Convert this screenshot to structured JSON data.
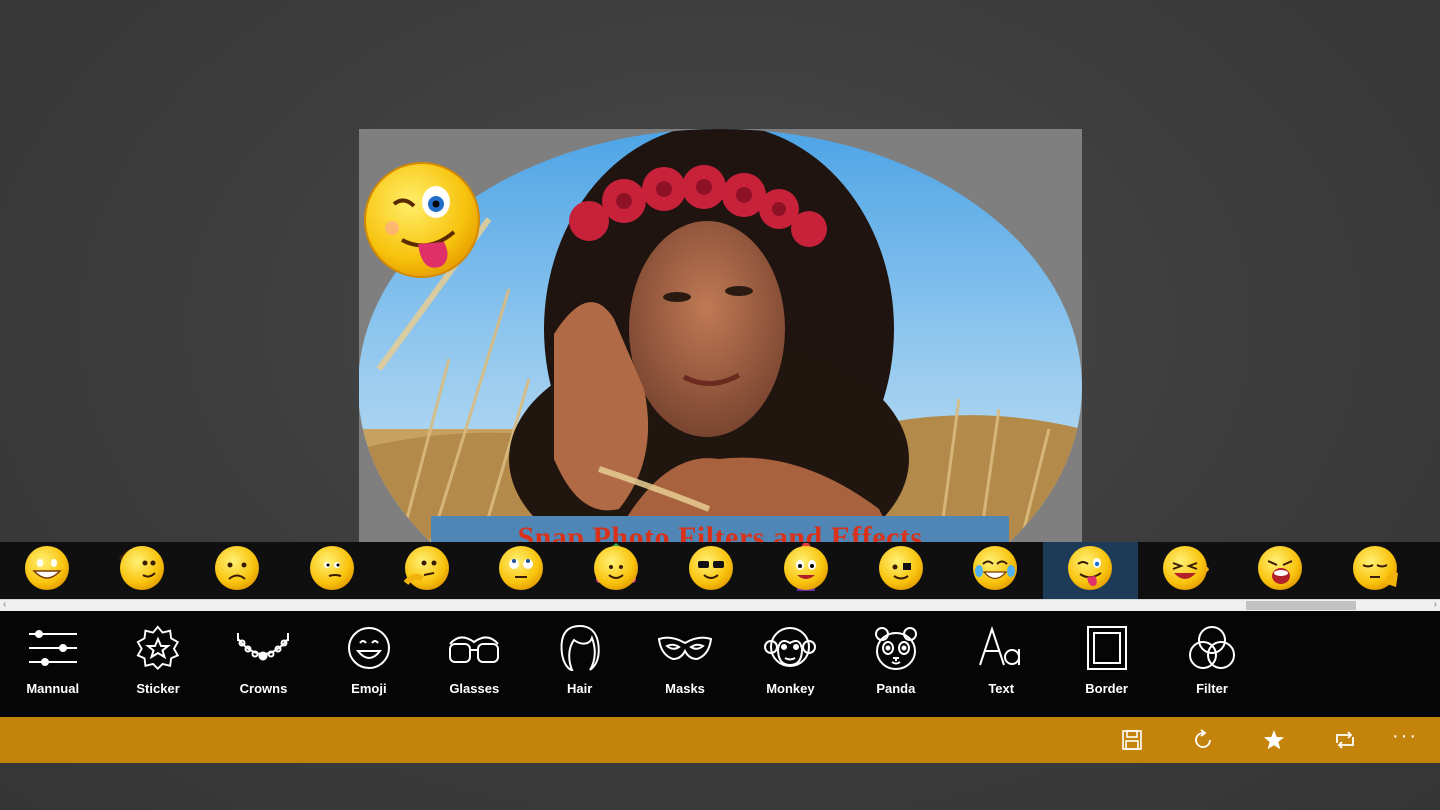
{
  "canvas": {
    "banner_text": "Snap Photo Filters and Effects"
  },
  "emoji_strip": {
    "items": [
      {
        "icon": "grinning-emoji-icon"
      },
      {
        "icon": "pointing-emoji-icon"
      },
      {
        "icon": "sad-emoji-icon"
      },
      {
        "icon": "peeking-emoji-icon"
      },
      {
        "icon": "thinking-emoji-icon"
      },
      {
        "icon": "eyeroll-emoji-icon"
      },
      {
        "icon": "festive-emoji-icon"
      },
      {
        "icon": "peace-sunglasses-emoji-icon"
      },
      {
        "icon": "party-emoji-icon"
      },
      {
        "icon": "pirate-emoji-icon"
      },
      {
        "icon": "tears-of-joy-emoji-icon"
      },
      {
        "icon": "winking-tongue-emoji-icon",
        "selected": true
      },
      {
        "icon": "laughing-pointing-emoji-icon"
      },
      {
        "icon": "shouting-emoji-icon"
      },
      {
        "icon": "facepalm-emoji-icon"
      }
    ]
  },
  "tools": [
    {
      "label": "Mannual",
      "icon": "sliders-icon"
    },
    {
      "label": "Sticker",
      "icon": "sticker-star-icon"
    },
    {
      "label": "Crowns",
      "icon": "crown-necklace-icon"
    },
    {
      "label": "Emoji",
      "icon": "smiley-icon"
    },
    {
      "label": "Glasses",
      "icon": "glasses-icon"
    },
    {
      "label": "Hair",
      "icon": "hair-icon"
    },
    {
      "label": "Masks",
      "icon": "mask-icon"
    },
    {
      "label": "Monkey",
      "icon": "monkey-icon"
    },
    {
      "label": "Panda",
      "icon": "panda-icon"
    },
    {
      "label": "Text",
      "icon": "text-aa-icon"
    },
    {
      "label": "Border",
      "icon": "border-frame-icon"
    },
    {
      "label": "Filter",
      "icon": "filter-circles-icon"
    }
  ],
  "command_bar": {
    "buttons": [
      "save-icon",
      "refresh-icon",
      "star-icon",
      "crop-rotate-icon"
    ],
    "more_label": "···"
  },
  "colors": {
    "command_bar": "#c4830a",
    "selected_emoji": "#1d3a57",
    "banner": "#4f86b6",
    "banner_text": "#d8321a"
  }
}
